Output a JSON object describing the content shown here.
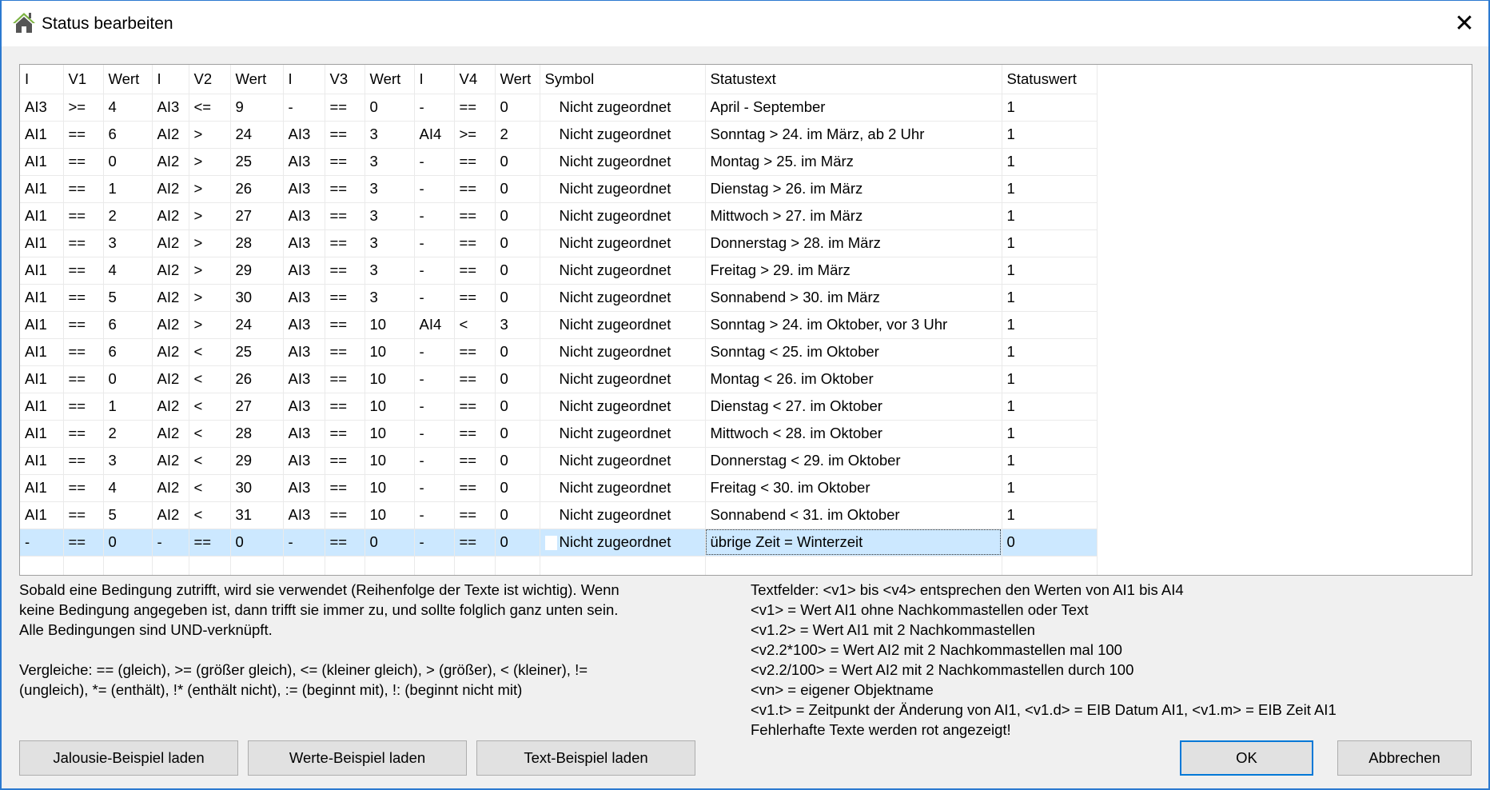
{
  "window": {
    "title": "Status bearbeiten",
    "close_glyph": "✕"
  },
  "table": {
    "headers": [
      "I",
      "V1",
      "Wert",
      "I",
      "V2",
      "Wert",
      "I",
      "V3",
      "Wert",
      "I",
      "V4",
      "Wert",
      "Symbol",
      "Statustext",
      "Statuswert"
    ],
    "rows": [
      [
        "AI3",
        ">=",
        "4",
        "AI3",
        "<=",
        "9",
        "-",
        "==",
        "0",
        "-",
        "==",
        "0",
        "Nicht zugeordnet",
        "April - September",
        "1"
      ],
      [
        "AI1",
        "==",
        "6",
        "AI2",
        ">",
        "24",
        "AI3",
        "==",
        "3",
        "AI4",
        ">=",
        "2",
        "Nicht zugeordnet",
        "Sonntag > 24. im März, ab 2 Uhr",
        "1"
      ],
      [
        "AI1",
        "==",
        "0",
        "AI2",
        ">",
        "25",
        "AI3",
        "==",
        "3",
        "-",
        "==",
        "0",
        "Nicht zugeordnet",
        "Montag > 25. im März",
        "1"
      ],
      [
        "AI1",
        "==",
        "1",
        "AI2",
        ">",
        "26",
        "AI3",
        "==",
        "3",
        "-",
        "==",
        "0",
        "Nicht zugeordnet",
        "Dienstag > 26. im März",
        "1"
      ],
      [
        "AI1",
        "==",
        "2",
        "AI2",
        ">",
        "27",
        "AI3",
        "==",
        "3",
        "-",
        "==",
        "0",
        "Nicht zugeordnet",
        "Mittwoch > 27. im März",
        "1"
      ],
      [
        "AI1",
        "==",
        "3",
        "AI2",
        ">",
        "28",
        "AI3",
        "==",
        "3",
        "-",
        "==",
        "0",
        "Nicht zugeordnet",
        "Donnerstag > 28. im März",
        "1"
      ],
      [
        "AI1",
        "==",
        "4",
        "AI2",
        ">",
        "29",
        "AI3",
        "==",
        "3",
        "-",
        "==",
        "0",
        "Nicht zugeordnet",
        "Freitag > 29. im März",
        "1"
      ],
      [
        "AI1",
        "==",
        "5",
        "AI2",
        ">",
        "30",
        "AI3",
        "==",
        "3",
        "-",
        "==",
        "0",
        "Nicht zugeordnet",
        "Sonnabend > 30. im März",
        "1"
      ],
      [
        "AI1",
        "==",
        "6",
        "AI2",
        ">",
        "24",
        "AI3",
        "==",
        "10",
        "AI4",
        "<",
        "3",
        "Nicht zugeordnet",
        "Sonntag > 24. im Oktober, vor 3 Uhr",
        "1"
      ],
      [
        "AI1",
        "==",
        "6",
        "AI2",
        "<",
        "25",
        "AI3",
        "==",
        "10",
        "-",
        "==",
        "0",
        "Nicht zugeordnet",
        "Sonntag < 25. im Oktober",
        "1"
      ],
      [
        "AI1",
        "==",
        "0",
        "AI2",
        "<",
        "26",
        "AI3",
        "==",
        "10",
        "-",
        "==",
        "0",
        "Nicht zugeordnet",
        "Montag < 26. im Oktober",
        "1"
      ],
      [
        "AI1",
        "==",
        "1",
        "AI2",
        "<",
        "27",
        "AI3",
        "==",
        "10",
        "-",
        "==",
        "0",
        "Nicht zugeordnet",
        "Dienstag < 27. im Oktober",
        "1"
      ],
      [
        "AI1",
        "==",
        "2",
        "AI2",
        "<",
        "28",
        "AI3",
        "==",
        "10",
        "-",
        "==",
        "0",
        "Nicht zugeordnet",
        "Mittwoch < 28. im Oktober",
        "1"
      ],
      [
        "AI1",
        "==",
        "3",
        "AI2",
        "<",
        "29",
        "AI3",
        "==",
        "10",
        "-",
        "==",
        "0",
        "Nicht zugeordnet",
        "Donnerstag < 29. im Oktober",
        "1"
      ],
      [
        "AI1",
        "==",
        "4",
        "AI2",
        "<",
        "30",
        "AI3",
        "==",
        "10",
        "-",
        "==",
        "0",
        "Nicht zugeordnet",
        "Freitag < 30. im Oktober",
        "1"
      ],
      [
        "AI1",
        "==",
        "5",
        "AI2",
        "<",
        "31",
        "AI3",
        "==",
        "10",
        "-",
        "==",
        "0",
        "Nicht zugeordnet",
        "Sonnabend < 31. im Oktober",
        "1"
      ],
      [
        "-",
        "==",
        "0",
        "-",
        "==",
        "0",
        "-",
        "==",
        "0",
        "-",
        "==",
        "0",
        "Nicht zugeordnet",
        "übrige Zeit = Winterzeit",
        "0"
      ]
    ],
    "selected_row": 16
  },
  "info_left": [
    "Sobald eine Bedingung zutrifft, wird sie verwendet (Reihenfolge der Texte ist wichtig). Wenn",
    "keine Bedingung angegeben ist, dann trifft sie immer zu, und sollte folglich ganz unten sein.",
    "Alle Bedingungen sind UND-verknüpft.",
    "",
    "Vergleiche: == (gleich), >= (größer gleich), <= (kleiner gleich), > (größer), < (kleiner), !=",
    "(ungleich), *= (enthält), !* (enthält nicht), := (beginnt mit), !: (beginnt nicht mit)"
  ],
  "info_right": [
    "Textfelder: <v1> bis <v4> entsprechen den Werten von AI1 bis AI4",
    "<v1> = Wert AI1 ohne Nachkommastellen oder Text",
    "<v1.2> = Wert AI1 mit 2 Nachkommastellen",
    "<v2.2*100> = Wert AI2 mit 2 Nachkommastellen mal 100",
    "<v2.2/100> = Wert AI2 mit 2 Nachkommastellen durch 100",
    "<vn> = eigener Objektname",
    "<v1.t> = Zeitpunkt der Änderung von AI1, <v1.d> = EIB Datum AI1, <v1.m> = EIB Zeit AI1",
    "Fehlerhafte Texte werden rot angezeigt!"
  ],
  "buttons": {
    "jalousie": "Jalousie-Beispiel laden",
    "werte": "Werte-Beispiel laden",
    "text": "Text-Beispiel laden",
    "ok": "OK",
    "cancel": "Abbrechen"
  }
}
